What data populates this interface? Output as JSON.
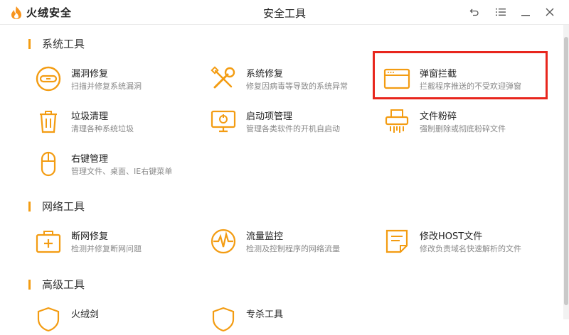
{
  "app": {
    "logo_text": "火绒安全",
    "window_title": "安全工具"
  },
  "window_controls": [
    {
      "name": "back-icon",
      "glyph": "↶"
    },
    {
      "name": "menu-icon",
      "glyph": "☰"
    },
    {
      "name": "minimize-icon",
      "glyph": "—"
    },
    {
      "name": "close-icon",
      "glyph": "✕"
    }
  ],
  "sections": {
    "system": {
      "title": "系统工具"
    },
    "network": {
      "title": "网络工具"
    },
    "advanced": {
      "title": "高级工具"
    }
  },
  "tools": {
    "vuln_fix": {
      "name": "漏洞修复",
      "desc": "扫描并修复系统漏洞",
      "icon": "bandage-icon"
    },
    "sys_repair": {
      "name": "系统修复",
      "desc": "修复因病毒等导致的系统异常",
      "icon": "wrench-icon"
    },
    "popup_block": {
      "name": "弹窗拦截",
      "desc": "拦截程序推送的不受欢迎弹窗",
      "icon": "browser-window-icon"
    },
    "trash_clean": {
      "name": "垃圾清理",
      "desc": "清理各种系统垃圾",
      "icon": "trash-icon"
    },
    "startup_mgr": {
      "name": "启动项管理",
      "desc": "管理各类软件的开机自启动",
      "icon": "monitor-power-icon"
    },
    "file_shred": {
      "name": "文件粉碎",
      "desc": "强制删除或彻底粉碎文件",
      "icon": "shredder-icon"
    },
    "context_mgr": {
      "name": "右键管理",
      "desc": "管理文件、桌面、IE右键菜单",
      "icon": "mouse-icon"
    },
    "net_repair": {
      "name": "断网修复",
      "desc": "检测并修复断网问题",
      "icon": "first-aid-icon"
    },
    "traffic_mon": {
      "name": "流量监控",
      "desc": "检测及控制程序的网络流量",
      "icon": "pulse-icon"
    },
    "host_edit": {
      "name": "修改HOST文件",
      "desc": "修改负责域名快速解析的文件",
      "icon": "document-icon"
    },
    "adv_1": {
      "name": "火绒剑",
      "desc": "",
      "icon": "shield-icon"
    },
    "adv_2": {
      "name": "专杀工具",
      "desc": "",
      "icon": "shield-icon"
    }
  },
  "colors": {
    "accent": "#f39c12",
    "highlight_box": "#e8261d"
  }
}
